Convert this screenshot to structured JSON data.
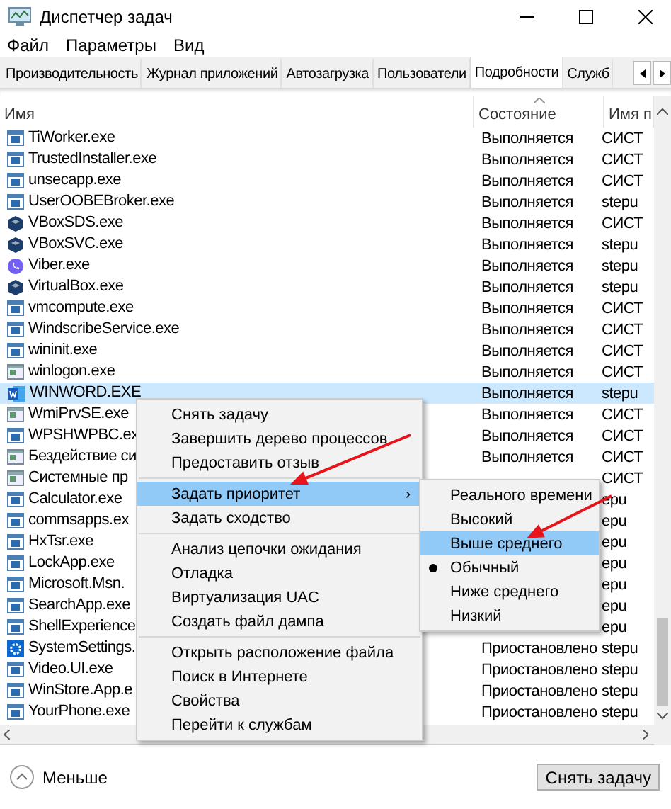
{
  "window": {
    "title": "Диспетчер задач"
  },
  "menu_bar": [
    "Файл",
    "Параметры",
    "Вид"
  ],
  "tabs": [
    {
      "label": "Производительность",
      "selected": false
    },
    {
      "label": "Журнал приложений",
      "selected": false
    },
    {
      "label": "Автозагрузка",
      "selected": false
    },
    {
      "label": "Пользователи",
      "selected": false
    },
    {
      "label": "Подробности",
      "selected": true
    },
    {
      "label": "Служб",
      "selected": false
    }
  ],
  "table": {
    "columns": [
      "Имя",
      "Состояние",
      "Имя п"
    ],
    "rows": [
      {
        "name": "TiWorker.exe",
        "kind": "app",
        "state": "Выполняется",
        "user": "СИСТ",
        "selected": false
      },
      {
        "name": "TrustedInstaller.exe",
        "kind": "app",
        "state": "Выполняется",
        "user": "СИСТ",
        "selected": false
      },
      {
        "name": "unsecapp.exe",
        "kind": "app",
        "state": "Выполняется",
        "user": "СИСТ",
        "selected": false
      },
      {
        "name": "UserOOBEBroker.exe",
        "kind": "app",
        "state": "Выполняется",
        "user": "stepu",
        "selected": false
      },
      {
        "name": "VBoxSDS.exe",
        "kind": "vbox",
        "state": "Выполняется",
        "user": "СИСТ",
        "selected": false
      },
      {
        "name": "VBoxSVC.exe",
        "kind": "vbox",
        "state": "Выполняется",
        "user": "stepu",
        "selected": false
      },
      {
        "name": "Viber.exe",
        "kind": "viber",
        "state": "Выполняется",
        "user": "stepu",
        "selected": false
      },
      {
        "name": "VirtualBox.exe",
        "kind": "vbox",
        "state": "Выполняется",
        "user": "stepu",
        "selected": false
      },
      {
        "name": "vmcompute.exe",
        "kind": "app",
        "state": "Выполняется",
        "user": "СИСТ",
        "selected": false
      },
      {
        "name": "WindscribeService.exe",
        "kind": "app",
        "state": "Выполняется",
        "user": "СИСТ",
        "selected": false
      },
      {
        "name": "wininit.exe",
        "kind": "app",
        "state": "Выполняется",
        "user": "СИСТ",
        "selected": false
      },
      {
        "name": "winlogon.exe",
        "kind": "system",
        "state": "Выполняется",
        "user": "СИСТ",
        "selected": false
      },
      {
        "name": "WINWORD.EXE",
        "kind": "word",
        "state": "Выполняется",
        "user": "stepu",
        "selected": true
      },
      {
        "name": "WmiPrvSE.exe",
        "kind": "system",
        "state": "Выполняется",
        "user": "СИСТ",
        "selected": false
      },
      {
        "name": "WPSHWPBC.ex",
        "kind": "app",
        "state": "Выполняется",
        "user": "СИСТ",
        "selected": false
      },
      {
        "name": "Бездействие си",
        "kind": "system",
        "state": "Выполняется",
        "user": "СИСТ",
        "selected": false
      },
      {
        "name": "Системные пр",
        "kind": "system",
        "user": "СИСТ",
        "selected": false
      },
      {
        "name": "Calculator.exe",
        "kind": "app",
        "user": "epu",
        "selected": false
      },
      {
        "name": "commsapps.ex",
        "kind": "app",
        "user": "epu",
        "selected": false
      },
      {
        "name": "HxTsr.exe",
        "kind": "app",
        "user": "epu",
        "selected": false
      },
      {
        "name": "LockApp.exe",
        "kind": "app",
        "user": "epu",
        "selected": false
      },
      {
        "name": "Microsoft.Msn.",
        "kind": "app",
        "user": "epu",
        "selected": false
      },
      {
        "name": "SearchApp.exe",
        "kind": "app",
        "user": "epu",
        "selected": false
      },
      {
        "name": "ShellExperience",
        "kind": "app",
        "user": "epu",
        "selected": false
      },
      {
        "name": "SystemSettings.",
        "kind": "settings",
        "state": "Приостановлено",
        "user": "stepu",
        "selected": false
      },
      {
        "name": "Video.UI.exe",
        "kind": "app",
        "state": "Приостановлено",
        "user": "stepu",
        "selected": false
      },
      {
        "name": "WinStore.App.e",
        "kind": "app",
        "state": "Приостановлено",
        "user": "stepu",
        "selected": false
      },
      {
        "name": "YourPhone.exe",
        "kind": "app",
        "state": "Приостановлено",
        "user": "stepu",
        "selected": false
      }
    ]
  },
  "context_menu": {
    "groups": [
      [
        {
          "label": "Снять задачу",
          "selected": false
        },
        {
          "label": "Завершить дерево процессов",
          "selected": false
        },
        {
          "label": "Предоставить отзыв",
          "selected": false
        }
      ],
      [
        {
          "label": "Задать приоритет",
          "selected": true,
          "submenu_arrow": "›"
        },
        {
          "label": "Задать сходство",
          "selected": false
        }
      ],
      [
        {
          "label": "Анализ цепочки ожидания",
          "selected": false
        },
        {
          "label": "Отладка",
          "selected": false
        },
        {
          "label": "Виртуализация UAC",
          "selected": false
        },
        {
          "label": "Создать файл дампа",
          "selected": false
        }
      ],
      [
        {
          "label": "Открыть расположение файла",
          "selected": false
        },
        {
          "label": "Поиск в Интернете",
          "selected": false
        },
        {
          "label": "Свойства",
          "selected": false
        },
        {
          "label": "Перейти к службам",
          "selected": false
        }
      ]
    ]
  },
  "submenu": [
    {
      "label": "Реального времени",
      "selected": false,
      "checked": false
    },
    {
      "label": "Высокий",
      "selected": false,
      "checked": false
    },
    {
      "label": "Выше среднего",
      "selected": true,
      "checked": false
    },
    {
      "label": "Обычный",
      "selected": false,
      "checked": true
    },
    {
      "label": "Ниже среднего",
      "selected": false,
      "checked": false
    },
    {
      "label": "Низкий",
      "selected": false,
      "checked": false
    }
  ],
  "footer": {
    "toggle": "Меньше",
    "button": "Снять задачу"
  }
}
